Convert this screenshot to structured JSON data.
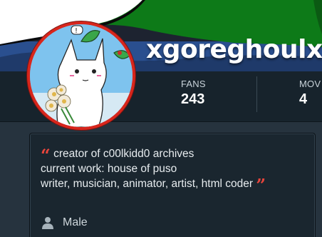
{
  "profile": {
    "username": "xgoreghoulx",
    "avatar_alt": "avatar"
  },
  "stats": {
    "fans_label": "FANS",
    "fans_value": "243",
    "movies_label": "MOV",
    "movies_value": "4"
  },
  "bio": {
    "open_quote": "“",
    "close_quote": "”",
    "line1": "creator of c00lkidd0 archives",
    "line2": "current work: house of puso",
    "line3": "writer, musician, animator, artist, html coder"
  },
  "details": {
    "gender_icon": "person-icon",
    "gender": "Male"
  },
  "colors": {
    "accent": "#e8453c",
    "avatar_ring": "#d8261c",
    "background": "#1d2a34"
  }
}
